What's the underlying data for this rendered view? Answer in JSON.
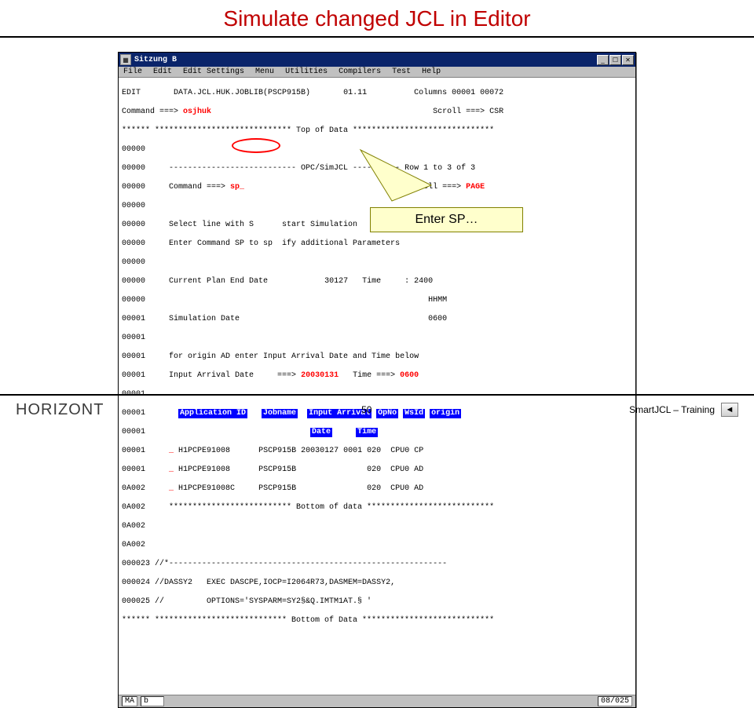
{
  "slide": {
    "title": "Simulate changed JCL in Editor",
    "page_number": "50"
  },
  "footer": {
    "brand": "HORIZONT",
    "product": "SmartJCL – Training",
    "nav_glyph": "◄"
  },
  "callout": {
    "text": "Enter SP…"
  },
  "window": {
    "title": "Sitzung B",
    "min": "_",
    "max": "☐",
    "close": "✕",
    "menu": [
      "File",
      "Edit",
      "Edit Settings",
      "Menu",
      "Utilities",
      "Compilers",
      "Test",
      "Help"
    ]
  },
  "editor": {
    "mode": "EDIT",
    "dataset": "DATA.JCL.HUK.JOBLIB(PSCP915B)",
    "pos": "01.11",
    "cols": "Columns 00001 00072",
    "cmd_label": "Command ===>",
    "cmd_value": "osjhuk",
    "scroll_label": "Scroll ===>",
    "scroll_value": "CSR",
    "top_banner": "****** ***************************** Top of Data ******************************"
  },
  "panel": {
    "rule": "--------------------------- OPC/SimJCL ---------- Row 1 to 3 of 3",
    "cmd_label": "Command ===>",
    "cmd_value": "sp_",
    "scroll_label": "Scroll ===>",
    "scroll_value": "PAGE",
    "instr1": "Select line with S      start Simulation",
    "instr2": "Enter Command SP to sp  ify additional Parameters",
    "cp_label": "Current Plan End Date",
    "cp_date": "  30127",
    "cp_time_label": "Time     :",
    "cp_time": "2400",
    "hhmm": "HHMM",
    "sim_label": "Simulation Date",
    "sim_time": "0600",
    "origin_instr": "for origin AD enter Input Arrival Date and Time below",
    "iad_label": "Input Arrival Date     ===>",
    "iad_date": "20030131",
    "iad_time_label": "Time ===>",
    "iad_time": "0600",
    "headers": {
      "app": "Application ID",
      "job": "Jobname",
      "iad": "Input Arrival",
      "date": "Date",
      "time": "Time",
      "opno": "OpNo",
      "wsid": "WsId",
      "origin": "origin"
    },
    "rows": [
      {
        "sel": "_",
        "app": "H1PCPE91008",
        "job": "PSCP915B",
        "date": "20030127",
        "time": "0001",
        "op": "020",
        "ws": "CPU0",
        "org": "CP"
      },
      {
        "sel": "_",
        "app": "H1PCPE91008",
        "job": "PSCP915B",
        "date": "",
        "time": "",
        "op": "020",
        "ws": "CPU0",
        "org": "AD"
      },
      {
        "sel": "_",
        "app": "H1PCPE91008C",
        "job": "PSCP915B",
        "date": "",
        "time": "",
        "op": "020",
        "ws": "CPU0",
        "org": "AD"
      }
    ],
    "bottom_banner": "************************** Bottom of data ***************************"
  },
  "src": {
    "ln_blank": "0A002 ",
    "l1": {
      "num": "0A002 ",
      "text": ""
    },
    "l2": {
      "num": "0A002 ",
      "text": ""
    },
    "l3": {
      "num": "000023",
      "text": " //*-----------------------------------------------------------"
    },
    "l4": {
      "num": "000024",
      "text": " //DASSY2   EXEC DASCPE,IOCP=I2064R73,DASMEM=DASSY2,"
    },
    "l5": {
      "num": "000025",
      "text": " //         OPTIONS='SYSPARM=SY2§&Q.IMTM1AT.§ '"
    },
    "bottom": "****** **************************** Bottom of Data ****************************"
  },
  "linenums": [
    "00000",
    "00000",
    "00000",
    "00000",
    "00000",
    "00000",
    "00000",
    "00000",
    "00000",
    "00001",
    "00001",
    "00001",
    "00001",
    "00001",
    "00001",
    "00001",
    "00001",
    "00001",
    "0A002"
  ],
  "status": {
    "left1": "MA",
    "left2": "b",
    "right": "08/025"
  }
}
